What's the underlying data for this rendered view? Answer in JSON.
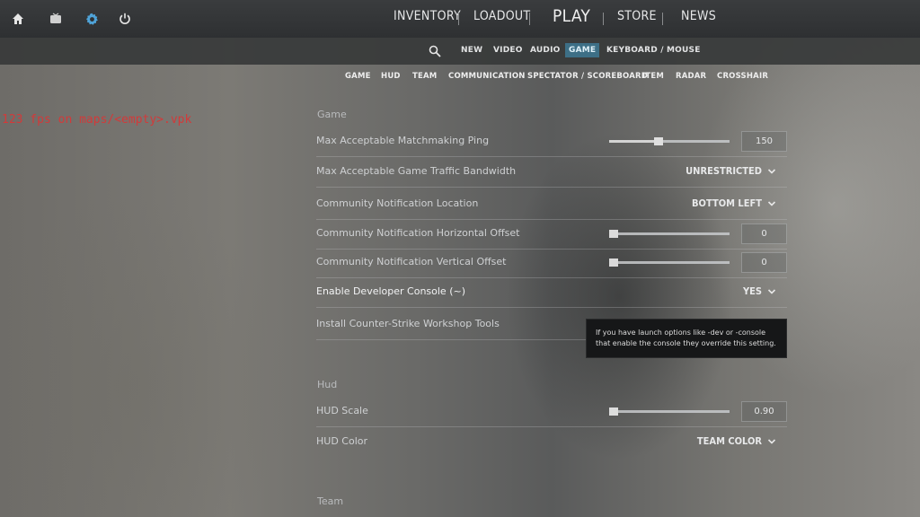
{
  "topbar": {
    "icons": [
      "home-icon",
      "tv-icon",
      "gear-icon",
      "power-icon"
    ],
    "accent": "#4fa3d8",
    "nav": [
      {
        "label": "INVENTORY"
      },
      {
        "label": "LOADOUT"
      },
      {
        "label": "PLAY"
      },
      {
        "label": "STORE"
      },
      {
        "label": "NEWS"
      }
    ]
  },
  "subnav": {
    "items": [
      "NEW",
      "VIDEO",
      "AUDIO",
      "GAME",
      "KEYBOARD / MOUSE"
    ],
    "active": "GAME",
    "active_color": "#3d6f86"
  },
  "categories": [
    "GAME",
    "HUD",
    "TEAM",
    "COMMUNICATION",
    "SPECTATOR / SCOREBOARD",
    "ITEM",
    "RADAR",
    "CROSSHAIR"
  ],
  "overlay": {
    "fps_text": "123 fps on maps/<empty>.vpk",
    "color": "#d23a3a"
  },
  "sections": {
    "game": {
      "title": "Game",
      "rows": [
        {
          "label": "Max Acceptable Matchmaking Ping",
          "type": "slider",
          "value": "150",
          "fraction": 0.4
        },
        {
          "label": "Max Acceptable Game Traffic Bandwidth",
          "type": "dropdown",
          "value": "UNRESTRICTED"
        },
        {
          "label": "Community Notification Location",
          "type": "dropdown",
          "value": "BOTTOM LEFT"
        },
        {
          "label": "Community Notification Horizontal Offset",
          "type": "slider",
          "value": "0",
          "fraction": 0.0
        },
        {
          "label": "Community Notification Vertical Offset",
          "type": "slider",
          "value": "0",
          "fraction": 0.0
        },
        {
          "label": "Enable Developer Console (~)",
          "type": "dropdown",
          "value": "YES"
        },
        {
          "label": "Install Counter-Strike Workshop Tools",
          "type": "dropdown",
          "value": ""
        }
      ]
    },
    "hud": {
      "title": "Hud",
      "rows": [
        {
          "label": "HUD Scale",
          "type": "slider",
          "value": "0.90",
          "fraction": 0.0
        },
        {
          "label": "HUD Color",
          "type": "dropdown",
          "value": "TEAM COLOR"
        }
      ]
    },
    "team": {
      "title": "Team"
    }
  },
  "tooltip": {
    "text": "If you have launch options like -dev or -console that enable the console they override this setting."
  }
}
